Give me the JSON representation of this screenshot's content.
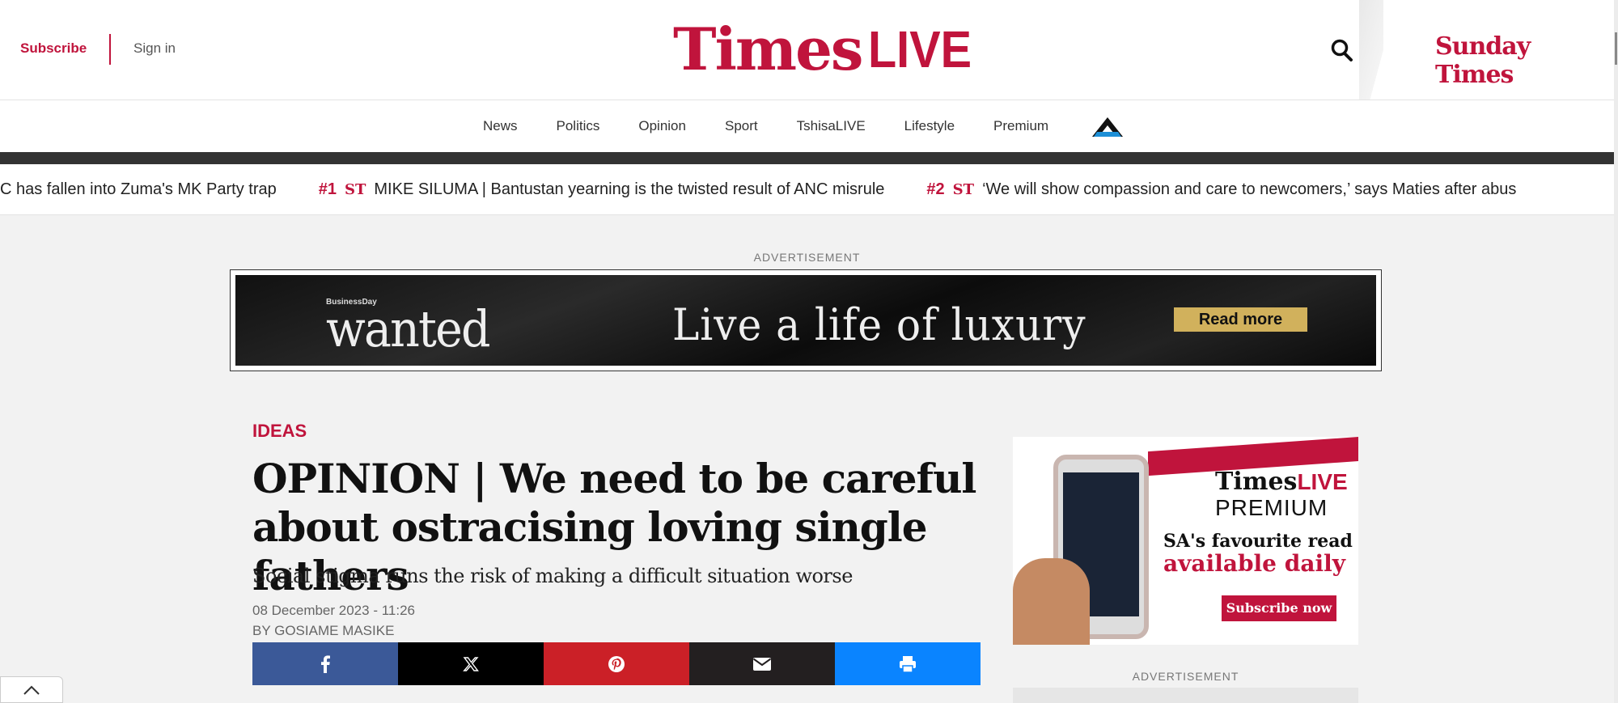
{
  "header": {
    "subscribe_label": "Subscribe",
    "signin_label": "Sign in",
    "logo_times": "Times",
    "logo_live": "LIVE",
    "sunday_times": "Sunday Times",
    "search_icon": "search-icon"
  },
  "nav": {
    "items": [
      "News",
      "Politics",
      "Opinion",
      "Sport",
      "TshisaLIVE",
      "Lifestyle",
      "Premium"
    ],
    "extra_logo": "a-logo-icon"
  },
  "ticker": {
    "lead_fragment": "C has fallen into Zuma's MK Party trap",
    "items": [
      {
        "rank": "#1",
        "icon": "ST",
        "text": "MIKE SILUMA | Bantustan yearning is the twisted result of ANC misrule"
      },
      {
        "rank": "#2",
        "icon": "ST",
        "text": "‘We will show compassion and care to newcomers,’ says Maties after abus"
      }
    ]
  },
  "ads": {
    "label_top": "ADVERTISEMENT",
    "label_side": "ADVERTISEMENT",
    "banner": {
      "brand_small": "BusinessDay",
      "brand": "wanted",
      "tagline": "Live a life of luxury",
      "cta": "Read more",
      "cta_color": "#d1b15c"
    }
  },
  "article": {
    "category": "IDEAS",
    "headline": "OPINION | We need to be careful about ostracising loving single fathers",
    "subheadline": "Social stigma runs the risk of making a difficult situation worse",
    "date": "08 December 2023 - 11:26",
    "byline": "BY GOSIAME MASIKE"
  },
  "share": {
    "buttons": [
      {
        "name": "facebook",
        "icon": "facebook-icon",
        "color": "#3b5998"
      },
      {
        "name": "x",
        "icon": "x-icon",
        "color": "#000000"
      },
      {
        "name": "pinterest",
        "icon": "pinterest-icon",
        "color": "#cb2027"
      },
      {
        "name": "email",
        "icon": "email-icon",
        "color": "#231f20"
      },
      {
        "name": "print",
        "icon": "print-icon",
        "color": "#0a84ff"
      }
    ]
  },
  "promo": {
    "brand_times": "Times",
    "brand_live": "LIVE",
    "brand_premium": "PREMIUM",
    "line1": "SA's favourite read",
    "line2": "available daily",
    "cta": "Subscribe now"
  },
  "colors": {
    "brand": "#c0143c",
    "nav_bar": "#333333",
    "page_bg": "#f2f2f2"
  }
}
